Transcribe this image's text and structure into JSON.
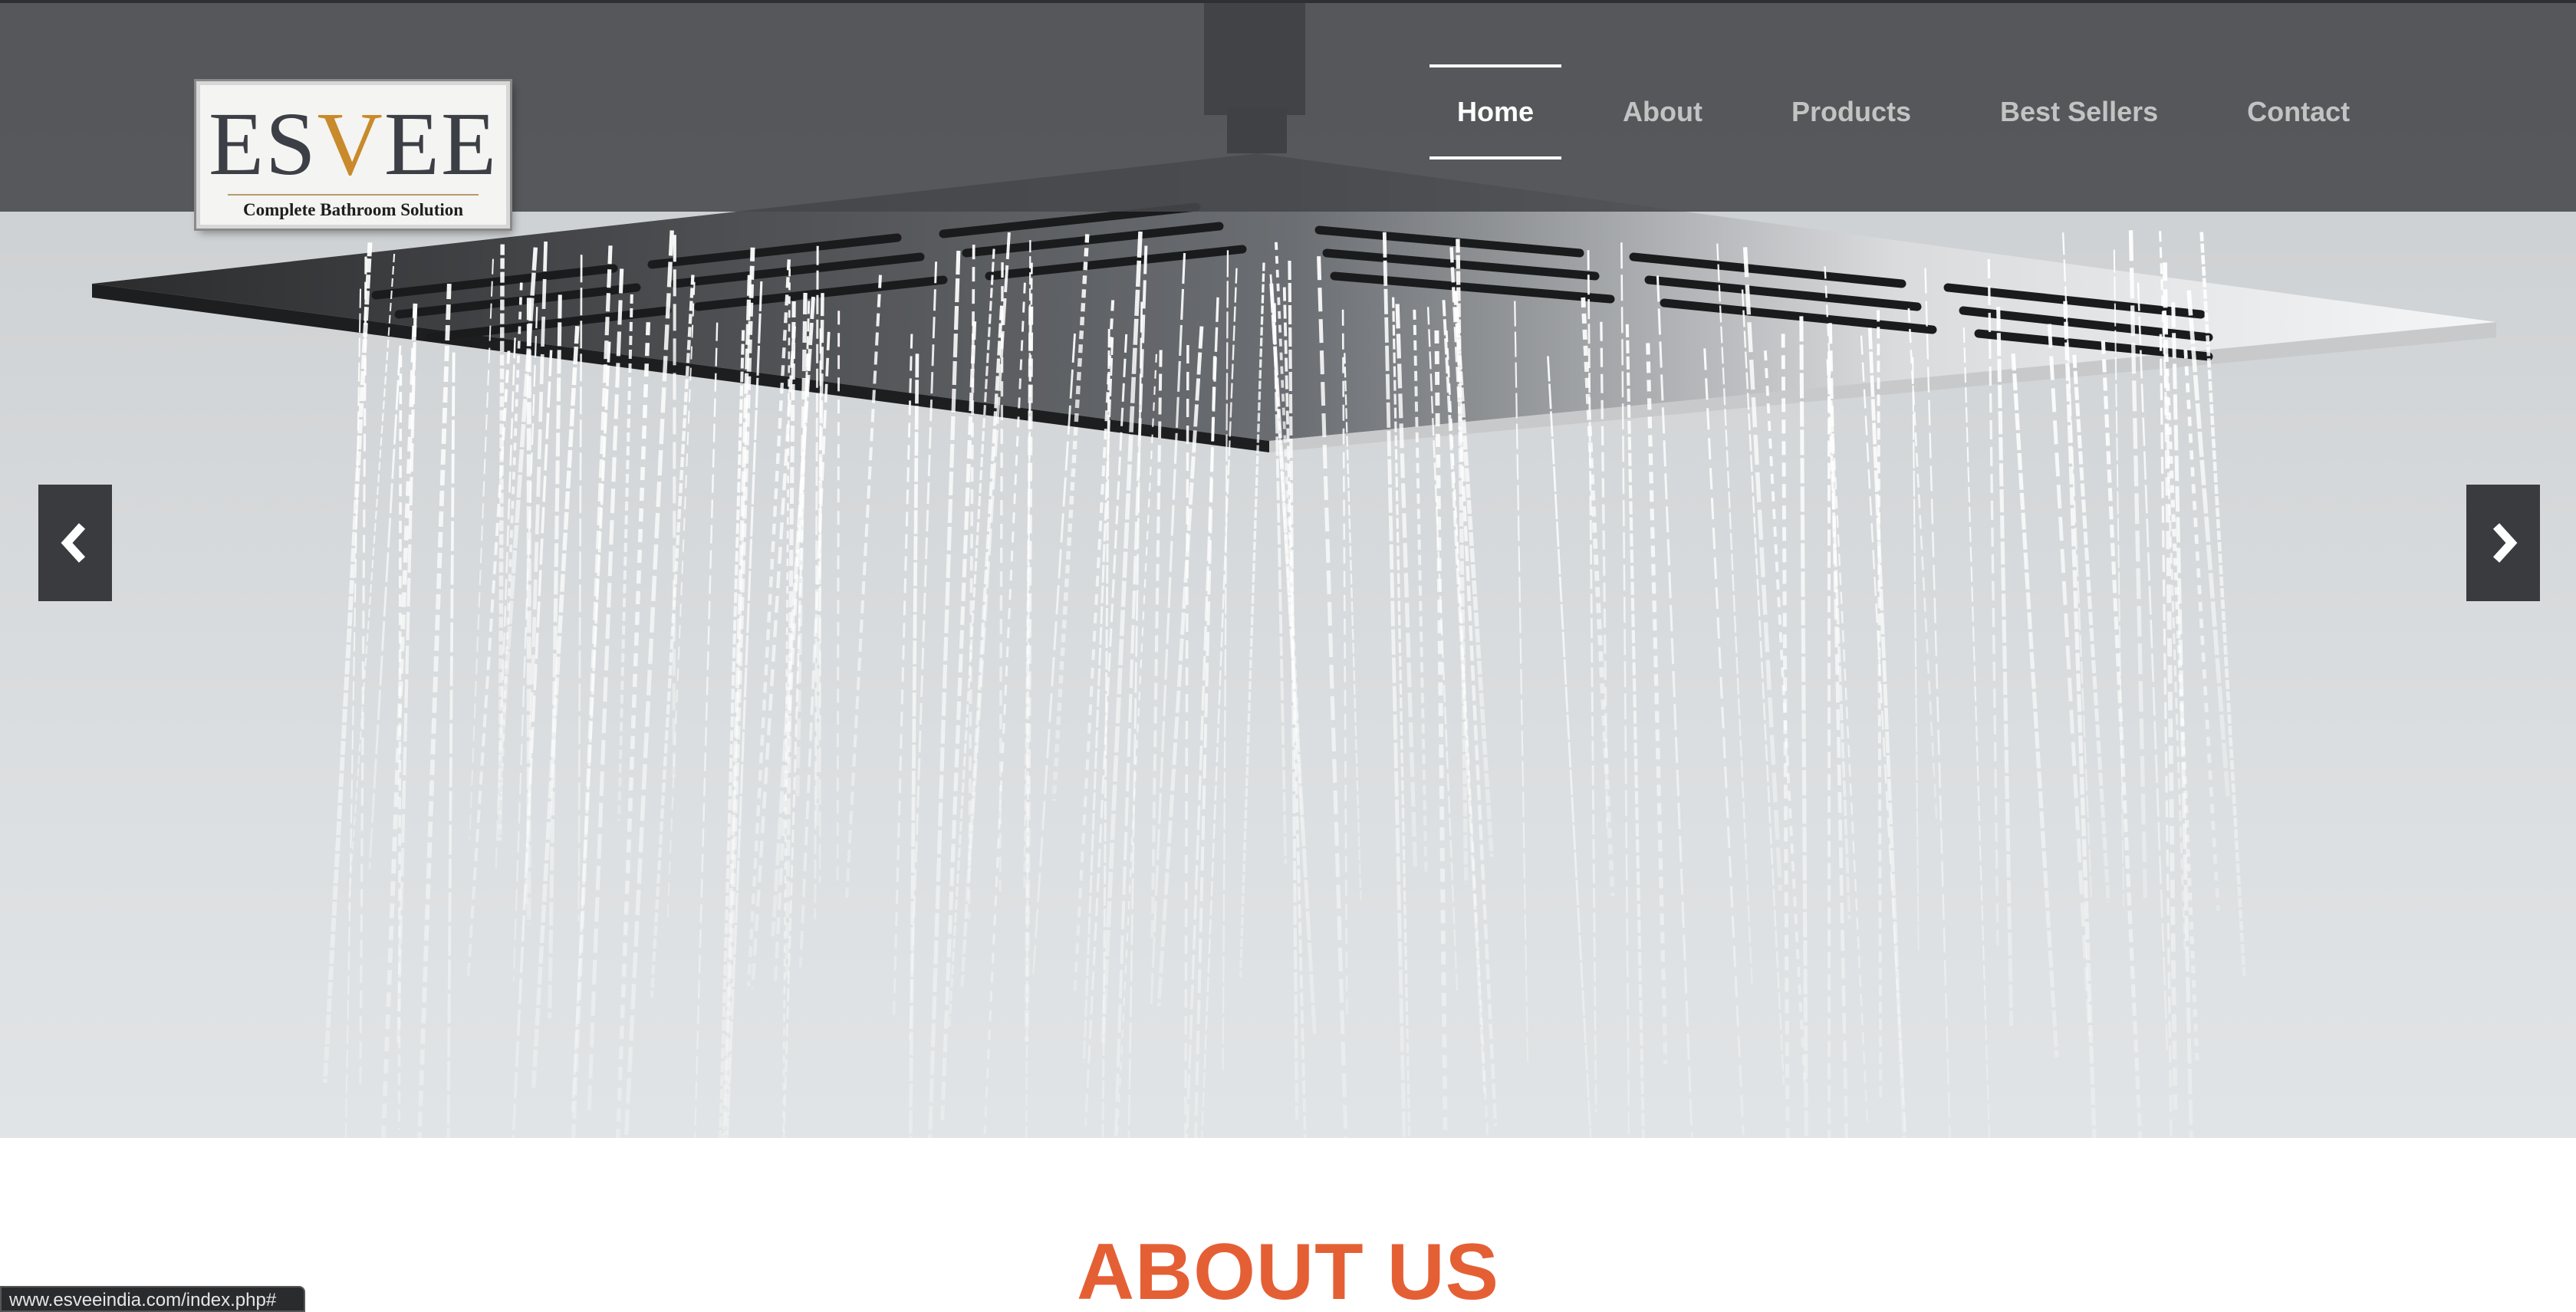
{
  "brand": {
    "logo_word_left": "ES",
    "logo_word_v": "V",
    "logo_word_right": "EE",
    "tagline": "Complete Bathroom Solution",
    "accent_color": "#c98a2c"
  },
  "nav": {
    "items": [
      {
        "label": "Home",
        "active": true
      },
      {
        "label": "About",
        "active": false
      },
      {
        "label": "Products",
        "active": false
      },
      {
        "label": "Best Sellers",
        "active": false
      },
      {
        "label": "Contact",
        "active": false
      }
    ]
  },
  "slider": {
    "prev_icon": "chevron-left-icon",
    "next_icon": "chevron-right-icon"
  },
  "about": {
    "title": "ABOUT US",
    "title_color": "#e55f35"
  },
  "status_bar": {
    "url": "www.esveeindia.com/index.php#"
  }
}
